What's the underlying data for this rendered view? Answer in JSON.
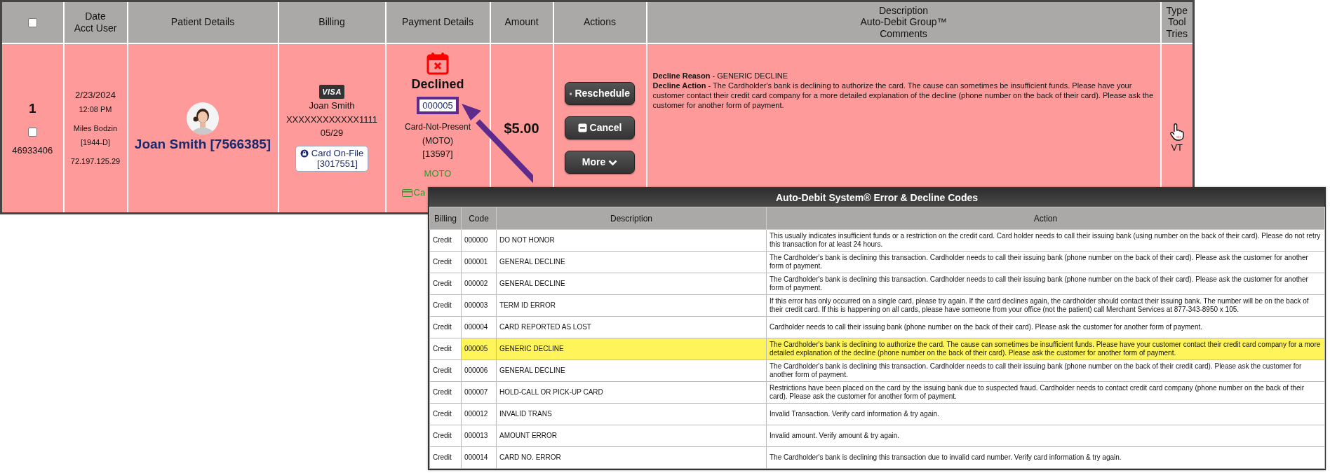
{
  "main_table": {
    "select_all": {
      "checked": false
    },
    "columns": [
      [
        "Date",
        "Acct User"
      ],
      [
        "Patient Details"
      ],
      [
        "Billing"
      ],
      [
        "Payment Details"
      ],
      [
        "Amount"
      ],
      [
        "Actions"
      ],
      [
        "Description",
        "Auto-Debit Group™",
        "Comments"
      ],
      [
        "Type",
        "Tool",
        "Tries"
      ]
    ],
    "row": {
      "number": "1",
      "checked": false,
      "id": "46933406",
      "date": "2/23/2024",
      "time": "12:08 PM",
      "user": "Miles Bodzin",
      "user_code": "[1944-D]",
      "ip": "72.197.125.29",
      "patient": "Joan Smith [7566385]",
      "card_brand": "VISA",
      "cardholder": "Joan Smith",
      "card_number": "XXXXXXXXXXXX1111",
      "expiry": "05/29",
      "card_on_file": [
        "Card On-File",
        "[3017551]"
      ],
      "status": "Declined",
      "decline_code": "000005",
      "payment_type": [
        "Card-Not-Present",
        "(MOTO)"
      ],
      "payment_ref": "[13597]",
      "channel": "MOTO",
      "card_link": "Ca",
      "amount": "$5.00",
      "actions": [
        {
          "label": "Reschedule",
          "kind": "reschedule"
        },
        {
          "label": "Cancel",
          "kind": "cancel"
        },
        {
          "label": "More",
          "kind": "more"
        }
      ],
      "decline_reason": "**Decline Reason** - GENERIC DECLINE",
      "decline_action": "**Decline Action** - The Cardholder's bank is declining to authorize the card. The cause can sometimes be insufficient funds. Please have your customer contact their credit card company for a more detailed explanation of the decline (phone number on the back of their card). Please ask the customer for another form of payment.",
      "tool": "VT"
    }
  },
  "codes": {
    "title": "Auto-Debit System® Error & Decline Codes",
    "columns": [
      "Billing",
      "Code",
      "Description",
      "Action"
    ],
    "rows": [
      {
        "billing": "Credit",
        "code": "000000",
        "description": "DO NOT HONOR",
        "action": "This usually indicates insufficient funds or a restriction on the credit card. Card holder needs to call their issuing bank (using number on the back of their card). Please do not retry this transaction for at least 24 hours.",
        "selected": false
      },
      {
        "billing": "Credit",
        "code": "000001",
        "description": "GENERAL DECLINE",
        "action": "The Cardholder's bank is declining this transaction. Cardholder needs to call their issuing bank (phone number on the back of their card). Please ask the customer for another form of payment.",
        "selected": false
      },
      {
        "billing": "Credit",
        "code": "000002",
        "description": "GENERAL DECLINE",
        "action": "The Cardholder's bank is declining this transaction. Cardholder needs to call their issuing bank (phone number on the back of their card). Please ask the customer for another form of payment.",
        "selected": false
      },
      {
        "billing": "Credit",
        "code": "000003",
        "description": "TERM ID ERROR",
        "action": "If this error has only occurred on a single card, please try again. If the card declines again, the cardholder should contact their issuing bank. The number will be on the back of their credit card. If this is happening on all cards, please have someone from your office (not the patient) call Merchant Services at 877-343-8950 x 105.",
        "selected": false
      },
      {
        "billing": "Credit",
        "code": "000004",
        "description": "CARD REPORTED AS LOST",
        "action": "Cardholder needs to call their issuing bank (phone number on the back of their card). Please ask the customer for another form of payment.",
        "selected": false
      },
      {
        "billing": "Credit",
        "code": "000005",
        "description": "GENERIC DECLINE",
        "action": "The Cardholder's bank is declining to authorize the card. The cause can sometimes be insufficient funds. Please have your customer contact their credit card company for a more detailed explanation of the decline (phone number on the back of their card). Please ask the customer for another form of payment.",
        "selected": true
      },
      {
        "billing": "Credit",
        "code": "000006",
        "description": "GENERAL DECLINE",
        "action": "The Cardholder's bank is declining this transaction. Cardholder needs to call their issuing bank (phone number on the back of their credit card). Please ask the customer for another form of payment.",
        "selected": false
      },
      {
        "billing": "Credit",
        "code": "000007",
        "description": "HOLD-CALL OR PICK-UP CARD",
        "action": "Restrictions have been placed on the card by the issuing bank due to suspected fraud. Cardholder needs to contact credit card company (phone number on the back of their card). Please ask the customer for another form of payment.",
        "selected": false
      },
      {
        "billing": "Credit",
        "code": "000012",
        "description": "INVALID TRANS",
        "action": "Invalid Transaction. Verify card information & try again.",
        "selected": false
      },
      {
        "billing": "Credit",
        "code": "000013",
        "description": "AMOUNT ERROR",
        "action": "Invalid amount. Verify amount & try again.",
        "selected": false
      },
      {
        "billing": "Credit",
        "code": "000014",
        "description": "CARD NO. ERROR",
        "action": "The Cardholder's bank is declining this transaction due to invalid card number. Verify card information & try again.",
        "selected": false
      }
    ]
  }
}
